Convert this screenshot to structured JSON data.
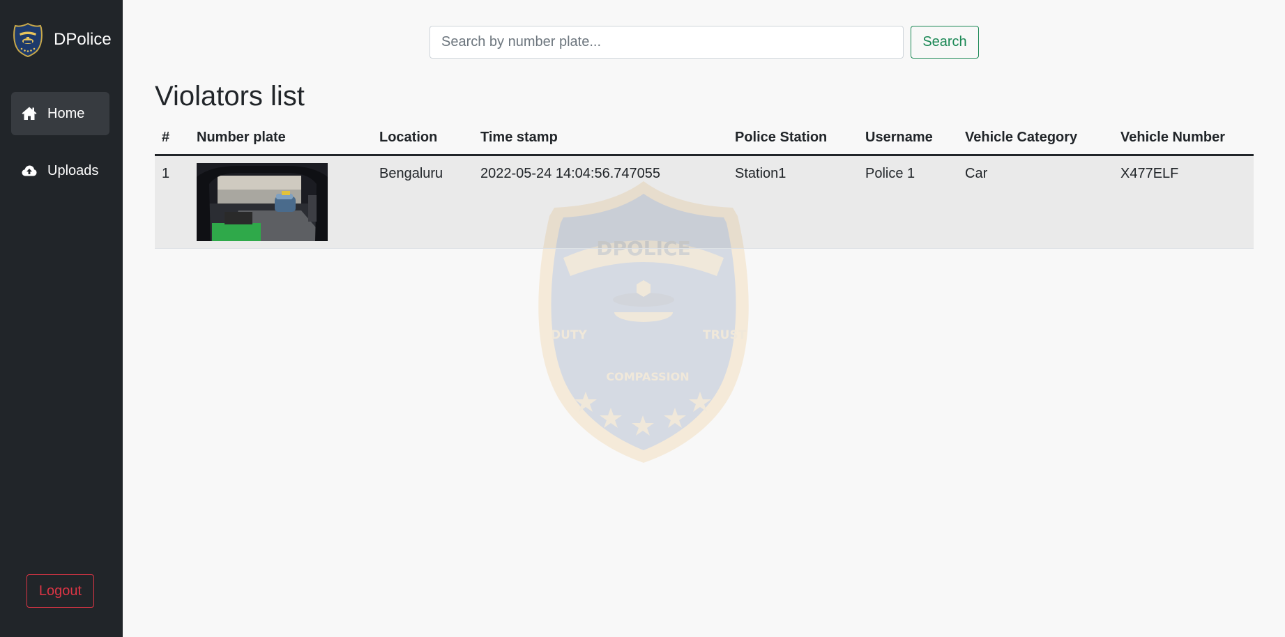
{
  "app": {
    "brand_name": "DPolice"
  },
  "sidebar": {
    "items": [
      {
        "label": "Home",
        "icon": "home-icon",
        "active": true
      },
      {
        "label": "Uploads",
        "icon": "cloud-upload-icon",
        "active": false
      }
    ],
    "logout_label": "Logout"
  },
  "search": {
    "placeholder": "Search by number plate...",
    "value": "",
    "button_label": "Search"
  },
  "page": {
    "title": "Violators list"
  },
  "table": {
    "headers": {
      "num": "#",
      "plate": "Number plate",
      "location": "Location",
      "timestamp": "Time stamp",
      "station": "Police Station",
      "username": "Username",
      "category": "Vehicle Category",
      "vehicle_number": "Vehicle Number"
    },
    "rows": [
      {
        "num": "1",
        "plate_image": "vehicle-photo",
        "location": "Bengaluru",
        "timestamp": "2022-05-24 14:04:56.747055",
        "station": "Station1",
        "username": "Police 1",
        "category": "Car",
        "vehicle_number": "X477ELF"
      }
    ]
  },
  "watermark": {
    "banner_text": "DPOLICE",
    "left_text": "DUTY",
    "right_text": "TRUST",
    "bottom_text": "COMPASSION"
  },
  "colors": {
    "sidebar_bg": "#212529",
    "active_nav_bg": "#373b40",
    "success": "#198754",
    "danger": "#dc3545",
    "page_bg": "#f8f8f8"
  }
}
